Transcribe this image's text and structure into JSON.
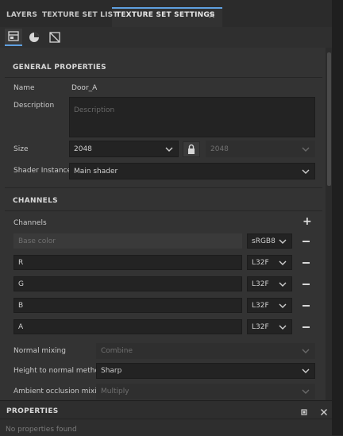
{
  "tabs": [
    {
      "label": "LAYERS"
    },
    {
      "label": "TEXTURE SET LIST"
    },
    {
      "label": "TEXTURE SET SETTINGS",
      "active": true
    }
  ],
  "icons": {
    "toolbar": [
      "texture-set-settings-icon",
      "material-sphere-icon",
      "uv-crop-icon"
    ],
    "close": "close-icon",
    "lock": "lock-icon",
    "add": "plus-icon",
    "remove": "minus-icon"
  },
  "general": {
    "header": "GENERAL PROPERTIES",
    "name_label": "Name",
    "name_value": "Door_A",
    "description_label": "Description",
    "description_placeholder": "Description",
    "size_label": "Size",
    "size_value": "2048",
    "size_linked_value": "2048",
    "shader_label": "Shader Instance",
    "shader_value": "Main shader"
  },
  "channels": {
    "header": "CHANNELS",
    "list_label": "Channels",
    "rows": [
      {
        "name": "Base color",
        "format": "sRGB8",
        "disabled": true
      },
      {
        "name": "R",
        "format": "L32F",
        "disabled": false
      },
      {
        "name": "G",
        "format": "L32F",
        "disabled": false
      },
      {
        "name": "B",
        "format": "L32F",
        "disabled": false
      },
      {
        "name": "A",
        "format": "L32F",
        "disabled": false
      }
    ],
    "normal_mixing_label": "Normal mixing",
    "normal_mixing_value": "Combine",
    "height_to_normal_label": "Height to normal method",
    "height_to_normal_value": "Sharp",
    "ao_mixing_label": "Ambient occlusion mixing",
    "ao_mixing_value": "Multiply"
  },
  "properties": {
    "title": "PROPERTIES",
    "empty_text": "No properties found"
  },
  "colors": {
    "accent": "#5fa0e0",
    "panel": "#333333",
    "field": "#232323"
  }
}
